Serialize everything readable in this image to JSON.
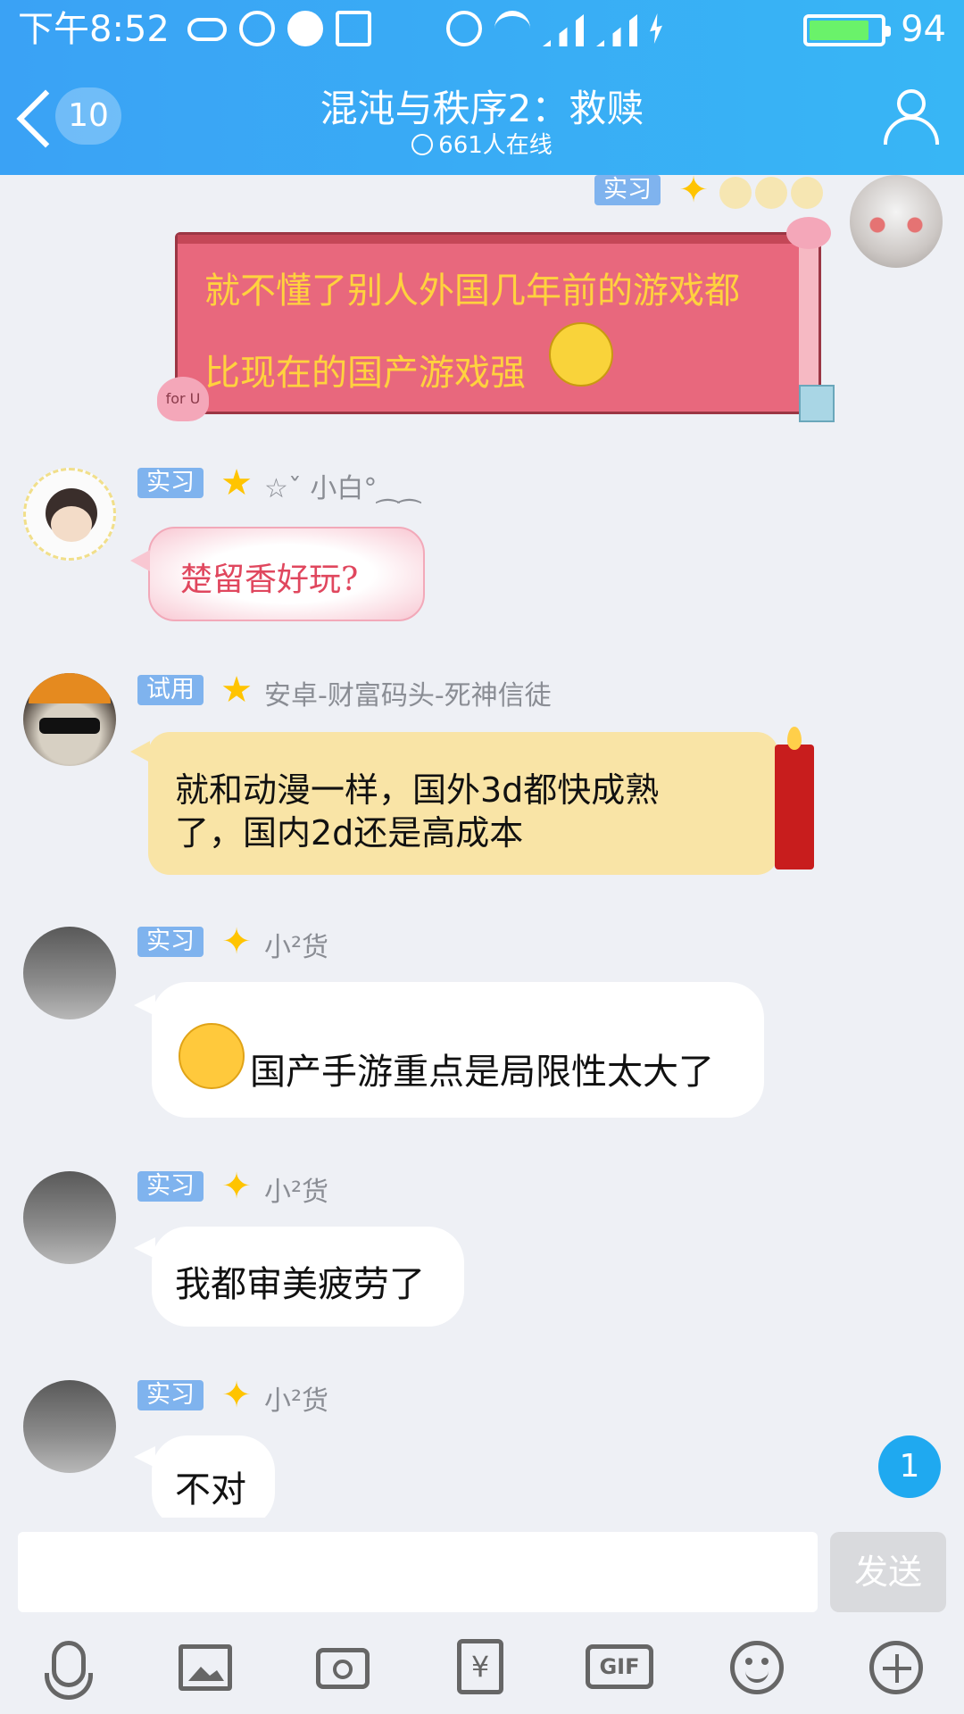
{
  "status_bar": {
    "time": "下午8:52",
    "battery": "94"
  },
  "header": {
    "back_count": "10",
    "title": "混沌与秩序2：救赎",
    "online": "661人在线"
  },
  "messages": [
    {
      "badge": "实习",
      "text_line1": "就不懂了别人外国几年前的游戏都",
      "text_line2": "比现在的国产游戏强",
      "sticker": "for U"
    },
    {
      "badge": "实习",
      "username": "☆ˇ 小白°⁔⁔",
      "text": "楚留香好玩?"
    },
    {
      "badge": "试用",
      "username": "安卓-财富码头-死神信徒",
      "text_line1": "就和动漫一样，国外3d都快成熟",
      "text_line2": "了，国内2d还是高成本"
    },
    {
      "badge": "实习",
      "username": "小²货",
      "text": "国产手游重点是局限性太大了"
    },
    {
      "badge": "实习",
      "username": "小²货",
      "text": "我都审美疲劳了"
    },
    {
      "badge": "实习",
      "username": "小²货",
      "text": "不对"
    }
  ],
  "new_message_count": "1",
  "input": {
    "value": "",
    "send_label": "发送"
  },
  "toolbar": {
    "icons": [
      "microphone-icon",
      "image-icon",
      "camera-icon",
      "red-packet-icon",
      "gif-icon",
      "emoji-icon",
      "plus-icon"
    ],
    "gif_label": "GIF",
    "yen_label": "¥"
  },
  "colors": {
    "header": "#3aa2f5",
    "badge": "#7fb3ee",
    "star": "#ffc400",
    "accent_blue": "#1fa9f0"
  }
}
